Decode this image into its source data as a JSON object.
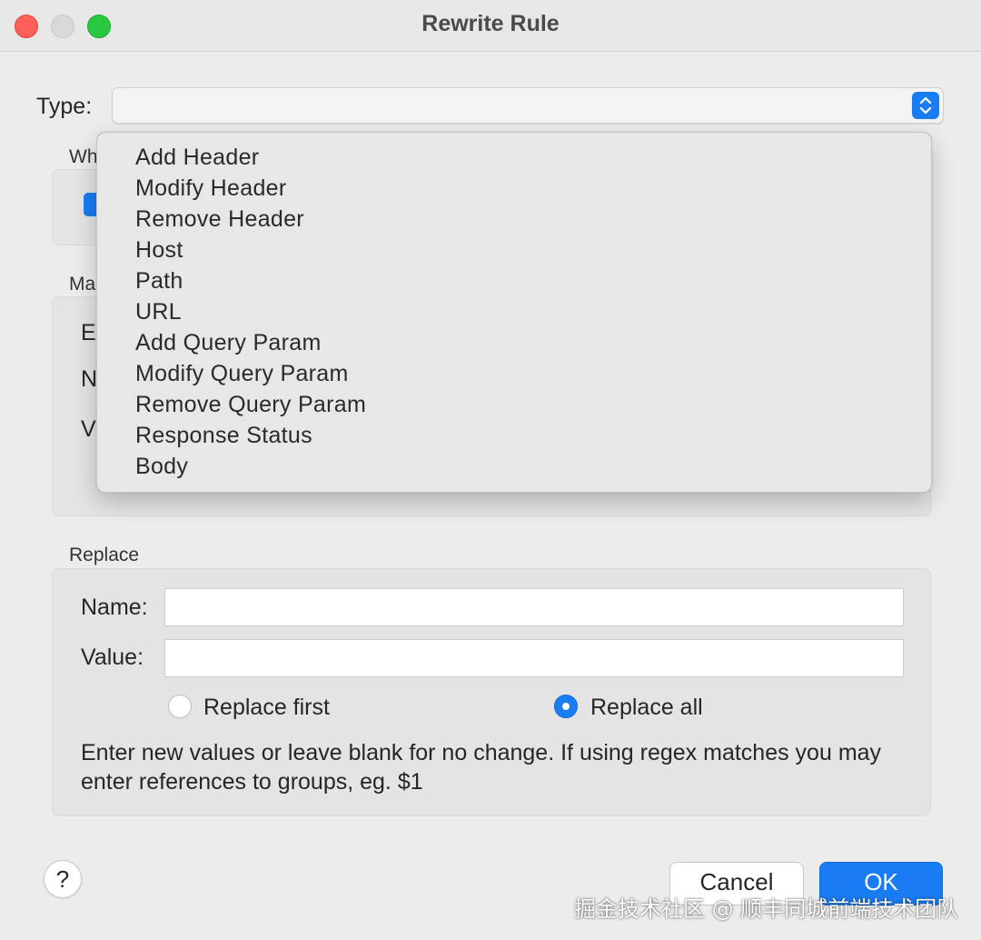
{
  "window": {
    "title": "Rewrite Rule"
  },
  "type": {
    "label": "Type:",
    "value": ""
  },
  "when_section": {
    "label_fragment": "Wh"
  },
  "match_section": {
    "label_fragment": "Ma",
    "row_fragments": [
      "E",
      "N",
      "V"
    ]
  },
  "dropdown": {
    "items": [
      "Add Header",
      "Modify Header",
      "Remove Header",
      "Host",
      "Path",
      "URL",
      "Add Query Param",
      "Modify Query Param",
      "Remove Query Param",
      "Response Status",
      "Body"
    ]
  },
  "replace": {
    "title": "Replace",
    "name_label": "Name:",
    "name_value": "",
    "value_label": "Value:",
    "value_value": "",
    "option_first": "Replace first",
    "option_all": "Replace all",
    "selected_option": "Replace all",
    "hint": "Enter new values or leave blank for no change. If using regex matches you may enter references to groups, eg. $1"
  },
  "buttons": {
    "help": "?",
    "cancel": "Cancel",
    "ok": "OK"
  },
  "watermark": "掘金技术社区 @ 顺丰同城前端技术团队",
  "colors": {
    "accent": "#1a7cf3",
    "close": "#fe5f57",
    "zoom": "#28c840"
  }
}
